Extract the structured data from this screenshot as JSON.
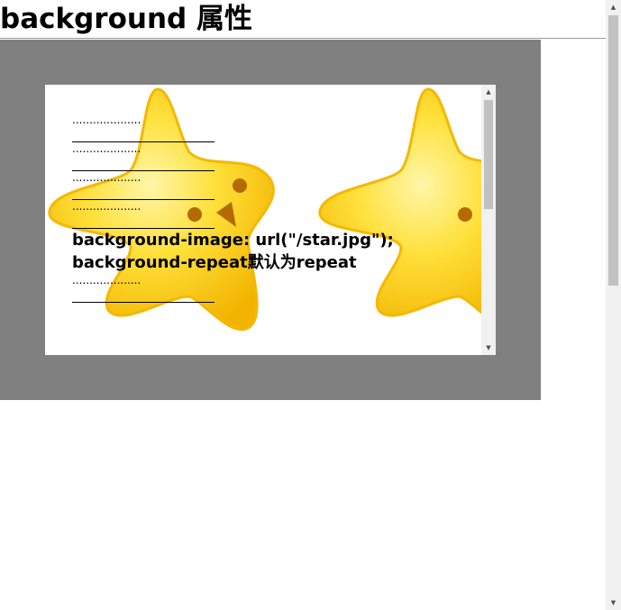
{
  "page": {
    "title": "background 属性"
  },
  "inner": {
    "dots": "....................",
    "line_image": "background-image: url(\"/star.jpg\");",
    "line_repeat": "background-repeat默认为repeat"
  },
  "icons": {
    "scroll_up": "triangle-up",
    "scroll_down": "triangle-down",
    "star_image": "star-face"
  },
  "colors": {
    "outer_box": "#808080",
    "star_fill": "#ffd21a",
    "star_edge": "#f5b800"
  }
}
